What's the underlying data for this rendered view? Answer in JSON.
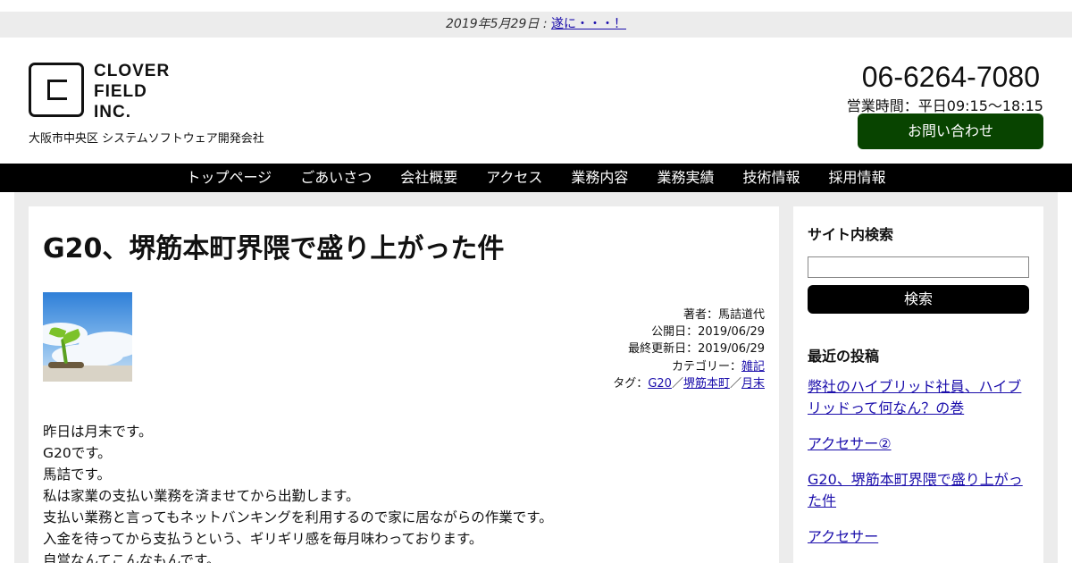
{
  "news": {
    "date": "2019年5月29日 : ",
    "link": "遂に・・・！"
  },
  "header": {
    "logo_lines": [
      "CLOVER",
      "FIELD",
      "INC."
    ],
    "tagline": "大阪市中央区 システムソフトウェア開発会社",
    "phone": "06-6264-7080",
    "hours": "営業時間：平日09:15〜18:15",
    "contact_label": "お問い合わせ"
  },
  "nav": {
    "items": [
      "トップページ",
      "ごあいさつ",
      "会社概要",
      "アクセス",
      "業務内容",
      "業務実績",
      "技術情報",
      "採用情報"
    ]
  },
  "article": {
    "title": "G20、堺筋本町界隈で盛り上がった件",
    "author": "著者：馬詰道代",
    "published": "公開日：2019/06/29",
    "updated": "最終更新日：2019/06/29",
    "category_label": "カテゴリー：",
    "category": "雑記",
    "tags_label": "タグ：",
    "tags": [
      "G20",
      "堺筋本町",
      "月末"
    ],
    "tag_sep": "／",
    "paragraphs": [
      "昨日は月末です。",
      "G20です。",
      "馬詰です。",
      "私は家業の支払い業務を済ませてから出勤します。",
      "支払い業務と言ってもネットバンキングを利用するので家に居ながらの作業です。",
      "入金を待ってから支払うという、ギリギリ感を毎月味わっております。",
      "自営なんてこんなもんです。"
    ]
  },
  "sidebar": {
    "search_heading": "サイト内検索",
    "search_value": "",
    "search_button": "検索",
    "recent_heading": "最近の投稿",
    "recent_posts": [
      "弊社のハイブリッド社員、ハイブリッドって何なん？の巻",
      "アクセサー②",
      "G20、堺筋本町界隈で盛り上がった件",
      "アクセサー"
    ]
  }
}
